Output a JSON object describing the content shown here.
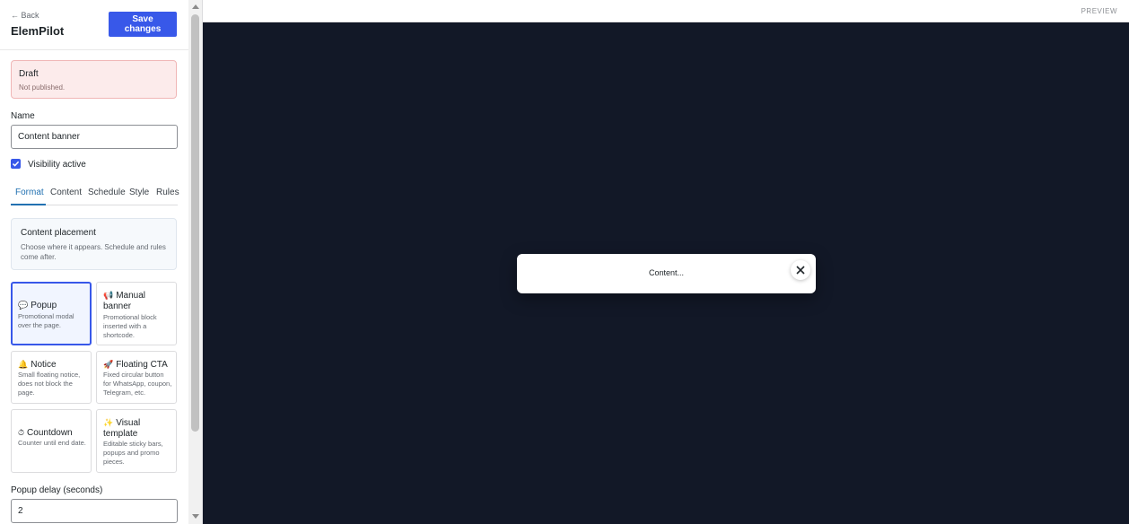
{
  "header": {
    "back_label": "← Back",
    "title": "ElemPilot",
    "save_label": "Save changes"
  },
  "status": {
    "title": "Draft",
    "subtitle": "Not published."
  },
  "name_field": {
    "label": "Name",
    "value": "Content banner"
  },
  "visibility": {
    "label": "Visibility active",
    "checked": true
  },
  "tabs": [
    {
      "label": "Format",
      "active": true
    },
    {
      "label": "Content"
    },
    {
      "label": "Schedule"
    },
    {
      "label": "Style"
    },
    {
      "label": "Rules"
    }
  ],
  "placement": {
    "title": "Content placement",
    "description": "Choose where it appears. Schedule and rules come after."
  },
  "formats": [
    {
      "icon": "speech-bubble-icon",
      "glyph": "💬",
      "label": "Popup",
      "description": "Promotional modal over the page.",
      "selected": true
    },
    {
      "icon": "megaphone-icon",
      "glyph": "📢",
      "label": "Manual banner",
      "description": "Promotional block inserted with a shortcode."
    },
    {
      "icon": "bell-icon",
      "glyph": "🔔",
      "label": "Notice",
      "description": "Small floating notice, does not block the page."
    },
    {
      "icon": "rocket-icon",
      "glyph": "🚀",
      "label": "Floating CTA",
      "description": "Fixed circular button for WhatsApp, coupon, Telegram, etc."
    },
    {
      "icon": "stopwatch-icon",
      "glyph": "⏱",
      "label": "Countdown",
      "description": "Counter until end date."
    },
    {
      "icon": "sparkles-icon",
      "glyph": "✨",
      "label": "Visual template",
      "description": "Editable sticky bars, popups and promo pieces."
    }
  ],
  "popup_delay": {
    "label": "Popup delay (seconds)",
    "value": "2"
  },
  "preview": {
    "label": "PREVIEW",
    "popup_text": "Content..."
  },
  "colors": {
    "accent": "#3858e9",
    "canvas": "#121827",
    "draft_bg": "#fcebeb"
  }
}
